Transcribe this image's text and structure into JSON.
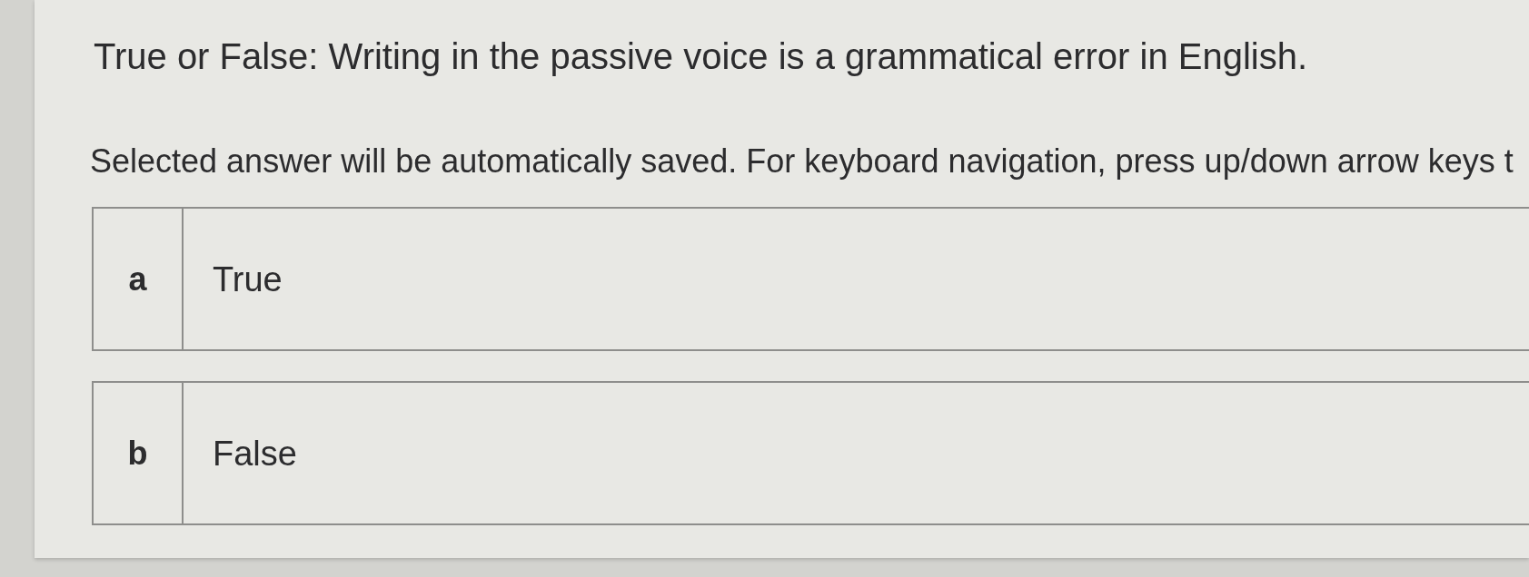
{
  "question": {
    "text": "True or False: Writing in the passive voice is a grammatical error in English."
  },
  "instructions": "Selected answer will be automatically saved. For keyboard navigation, press up/down arrow keys t",
  "options": [
    {
      "letter": "a",
      "text": "True",
      "selected": false
    },
    {
      "letter": "b",
      "text": "False",
      "selected": false
    }
  ]
}
